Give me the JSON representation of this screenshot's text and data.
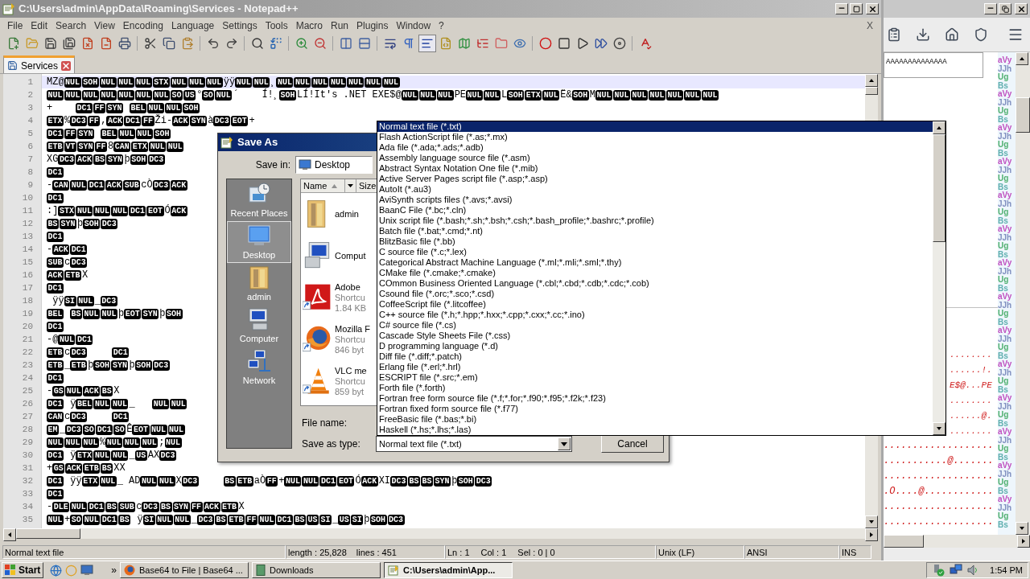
{
  "window": {
    "title": "C:\\Users\\admin\\AppData\\Roaming\\Services - Notepad++",
    "doc_close": "X"
  },
  "menu": [
    "File",
    "Edit",
    "Search",
    "View",
    "Encoding",
    "Language",
    "Settings",
    "Tools",
    "Macro",
    "Run",
    "Plugins",
    "Window",
    "?"
  ],
  "toolbar": [
    {
      "pressed": false
    },
    {
      "pressed": false
    },
    {
      "pressed": false
    },
    {
      "pressed": false
    },
    {
      "pressed": false
    },
    {
      "pressed": false
    },
    {
      "pressed": false
    },
    {
      "pressed": false
    },
    {
      "pressed": false
    },
    {
      "pressed": false
    },
    {
      "pressed": false
    },
    {
      "pressed": false
    },
    {
      "pressed": false
    },
    {
      "pressed": false
    },
    {
      "pressed": false
    },
    {
      "pressed": false
    },
    {
      "pressed": false
    },
    {
      "pressed": false
    },
    {
      "pressed": false
    },
    {
      "pressed": false
    },
    {
      "pressed": true
    },
    {
      "pressed": false
    },
    {
      "pressed": false
    },
    {
      "pressed": false
    },
    {
      "pressed": false
    },
    {
      "pressed": false
    },
    {
      "pressed": false
    },
    {
      "pressed": false
    },
    {
      "pressed": false
    },
    {
      "pressed": false
    },
    {
      "pressed": false
    },
    {
      "pressed": false
    }
  ],
  "tabs": [
    {
      "label": "Services",
      "selected": true
    }
  ],
  "editor": {
    "lines": [
      {
        "num": "1",
        "current": true,
        "segments": [
          {
            "kind": "text",
            "text": "MZ@"
          },
          {
            "kind": "ctrl",
            "codes": [
              "NUL",
              "SOH",
              "NUL",
              "NUL",
              "NUL",
              "STX",
              "NUL",
              "NUL",
              "NUL"
            ]
          },
          {
            "kind": "text",
            "text": "ÿÿ"
          },
          {
            "kind": "ctrl",
            "codes": [
              "NUL",
              "NUL"
            ]
          },
          {
            "kind": "text",
            "text": "¸"
          },
          {
            "kind": "ctrl",
            "codes": [
              "NUL",
              "NUL",
              "NUL",
              "NUL",
              "NUL",
              "NUL",
              "NUL"
            ]
          }
        ]
      },
      {
        "num": "2",
        "current": false,
        "segments": [
          {
            "kind": "ctrl",
            "codes": [
              "NUL",
              "NUL",
              "NUL",
              "NUL",
              "NUL",
              "NUL",
              "NUL",
              "SO",
              "US"
            ]
          },
          {
            "kind": "text",
            "text": "°"
          },
          {
            "kind": "ctrl",
            "codes": [
              "SO",
              "NUL"
            ]
          },
          {
            "kind": "text",
            "text": "´    Í!¸"
          },
          {
            "kind": "ctrl",
            "codes": [
              "SOH"
            ]
          },
          {
            "kind": "text",
            "text": "LÍ!It's .NET EXE$@"
          },
          {
            "kind": "ctrl",
            "codes": [
              "NUL",
              "NUL",
              "NUL"
            ]
          },
          {
            "kind": "text",
            "text": "PE"
          },
          {
            "kind": "ctrl",
            "codes": [
              "NUL",
              "NUL"
            ]
          },
          {
            "kind": "text",
            "text": "L"
          },
          {
            "kind": "ctrl",
            "codes": [
              "SOH",
              "ETX",
              "NUL"
            ]
          },
          {
            "kind": "text",
            "text": "Ë&"
          },
          {
            "kind": "ctrl",
            "codes": [
              "SOH"
            ]
          },
          {
            "kind": "text",
            "text": "M"
          },
          {
            "kind": "ctrl",
            "codes": [
              "NUL",
              "NUL",
              "NUL",
              "NUL",
              "NUL",
              "NUL",
              "NUL"
            ]
          }
        ]
      },
      {
        "num": "3",
        "current": false,
        "segments": [
          {
            "kind": "text",
            "text": "+    "
          },
          {
            "kind": "ctrl",
            "codes": [
              "DC1",
              "FF",
              "SYN"
            ]
          },
          {
            "kind": "space"
          },
          {
            "kind": "ctrl",
            "codes": [
              "BEL",
              "NUL",
              "NUL",
              "SOH"
            ]
          }
        ]
      },
      {
        "num": "4",
        "current": false,
        "segments": [
          {
            "kind": "ctrl",
            "codes": [
              "ETX"
            ]
          },
          {
            "kind": "text",
            "text": "%"
          },
          {
            "kind": "ctrl",
            "codes": [
              "DC3",
              "FF"
            ]
          },
          {
            "kind": "text",
            "text": ","
          },
          {
            "kind": "ctrl",
            "codes": [
              "ACK",
              "DC1",
              "FF"
            ]
          },
          {
            "kind": "text",
            "text": "Ži-"
          },
          {
            "kind": "ctrl",
            "codes": [
              "ACK",
              "SYN"
            ]
          },
          {
            "kind": "text",
            "text": "à"
          },
          {
            "kind": "ctrl",
            "codes": [
              "DC3",
              "EOT"
            ]
          },
          {
            "kind": "text",
            "text": "+"
          }
        ]
      },
      {
        "num": "5",
        "current": false,
        "segments": [
          {
            "kind": "ctrl",
            "codes": [
              "DC1",
              "FF",
              "SYN"
            ]
          },
          {
            "kind": "space"
          },
          {
            "kind": "ctrl",
            "codes": [
              "BEL",
              "NUL",
              "NUL",
              "SOH"
            ]
          }
        ]
      },
      {
        "num": "6",
        "current": false,
        "segments": [
          {
            "kind": "ctrl",
            "codes": [
              "ETB",
              "VT",
              "SYN",
              "FF"
            ]
          },
          {
            "kind": "text",
            "text": "8"
          },
          {
            "kind": "ctrl",
            "codes": [
              "CAN",
              "ETX",
              "NUL",
              "NUL"
            ]
          }
        ]
      },
      {
        "num": "7",
        "current": false,
        "segments": [
          {
            "kind": "text",
            "text": "XG"
          },
          {
            "kind": "ctrl",
            "codes": [
              "DC3",
              "ACK",
              "BS",
              "SYN"
            ]
          },
          {
            "kind": "text",
            "text": "þ"
          },
          {
            "kind": "ctrl",
            "codes": [
              "SOH",
              "DC3"
            ]
          }
        ]
      },
      {
        "num": "8",
        "current": false,
        "segments": [
          {
            "kind": "ctrl",
            "codes": [
              "DC1"
            ]
          }
        ]
      },
      {
        "num": "9",
        "current": false,
        "segments": [
          {
            "kind": "text",
            "text": "-"
          },
          {
            "kind": "ctrl",
            "codes": [
              "CAN",
              "NUL",
              "DC1",
              "ACK",
              "SUB"
            ]
          },
          {
            "kind": "text",
            "text": "cÒ"
          },
          {
            "kind": "ctrl",
            "codes": [
              "DC3",
              "ACK"
            ]
          }
        ]
      },
      {
        "num": "10",
        "current": false,
        "segments": [
          {
            "kind": "ctrl",
            "codes": [
              "DC1"
            ]
          }
        ]
      },
      {
        "num": "11",
        "current": false,
        "segments": [
          {
            "kind": "text",
            "text": ":]"
          },
          {
            "kind": "ctrl",
            "codes": [
              "STX",
              "NUL",
              "NUL",
              "NUL",
              "DC1",
              "EOT"
            ]
          },
          {
            "kind": "text",
            "text": "Ó"
          },
          {
            "kind": "ctrl",
            "codes": [
              "ACK"
            ]
          }
        ]
      },
      {
        "num": "12",
        "current": false,
        "segments": [
          {
            "kind": "ctrl",
            "codes": [
              "BS",
              "SYN"
            ]
          },
          {
            "kind": "text",
            "text": "þ"
          },
          {
            "kind": "ctrl",
            "codes": [
              "SOH",
              "DC3"
            ]
          }
        ]
      },
      {
        "num": "13",
        "current": false,
        "segments": [
          {
            "kind": "ctrl",
            "codes": [
              "DC1"
            ]
          }
        ]
      },
      {
        "num": "14",
        "current": false,
        "segments": [
          {
            "kind": "text",
            "text": "-"
          },
          {
            "kind": "ctrl",
            "codes": [
              "ACK",
              "DC1"
            ]
          }
        ]
      },
      {
        "num": "15",
        "current": false,
        "segments": [
          {
            "kind": "ctrl",
            "codes": [
              "SUB"
            ]
          },
          {
            "kind": "text",
            "text": "c"
          },
          {
            "kind": "ctrl",
            "codes": [
              "DC3"
            ]
          }
        ]
      },
      {
        "num": "16",
        "current": false,
        "segments": [
          {
            "kind": "ctrl",
            "codes": [
              "ACK",
              "ETB"
            ]
          },
          {
            "kind": "text",
            "text": "X"
          }
        ]
      },
      {
        "num": "17",
        "current": false,
        "segments": [
          {
            "kind": "ctrl",
            "codes": [
              "DC1"
            ]
          }
        ]
      },
      {
        "num": "18",
        "current": false,
        "segments": [
          {
            "kind": "text",
            "text": " ÿÿ"
          },
          {
            "kind": "ctrl",
            "codes": [
              "SI",
              "NUL"
            ]
          },
          {
            "kind": "text",
            "text": "_"
          },
          {
            "kind": "ctrl",
            "codes": [
              "DC3"
            ]
          }
        ]
      },
      {
        "num": "19",
        "current": false,
        "segments": [
          {
            "kind": "ctrl",
            "codes": [
              "BEL"
            ]
          },
          {
            "kind": "space"
          },
          {
            "kind": "ctrl",
            "codes": [
              "BS",
              "NUL",
              "NUL"
            ]
          },
          {
            "kind": "text",
            "text": "þ"
          },
          {
            "kind": "ctrl",
            "codes": [
              "EOT",
              "SYN"
            ]
          },
          {
            "kind": "text",
            "text": "þ"
          },
          {
            "kind": "ctrl",
            "codes": [
              "SOH"
            ]
          }
        ]
      },
      {
        "num": "20",
        "current": false,
        "segments": [
          {
            "kind": "ctrl",
            "codes": [
              "DC1"
            ]
          }
        ]
      },
      {
        "num": "21",
        "current": false,
        "segments": [
          {
            "kind": "text",
            "text": "-@"
          },
          {
            "kind": "ctrl",
            "codes": [
              "NUL",
              "DC1"
            ]
          }
        ]
      },
      {
        "num": "22",
        "current": false,
        "segments": [
          {
            "kind": "ctrl",
            "codes": [
              "ETB"
            ]
          },
          {
            "kind": "text",
            "text": "c"
          },
          {
            "kind": "ctrl",
            "codes": [
              "DC3"
            ]
          },
          {
            "kind": "tab"
          },
          {
            "kind": "ctrl",
            "codes": [
              "DC1"
            ]
          }
        ]
      },
      {
        "num": "23",
        "current": false,
        "segments": [
          {
            "kind": "ctrl",
            "codes": [
              "ETB"
            ]
          },
          {
            "kind": "text",
            "text": "_"
          },
          {
            "kind": "ctrl",
            "codes": [
              "ETB"
            ]
          },
          {
            "kind": "text",
            "text": "þ"
          },
          {
            "kind": "ctrl",
            "codes": [
              "SOH",
              "SYN"
            ]
          },
          {
            "kind": "text",
            "text": "þ"
          },
          {
            "kind": "ctrl",
            "codes": [
              "SOH",
              "DC3"
            ]
          }
        ]
      },
      {
        "num": "24",
        "current": false,
        "segments": [
          {
            "kind": "ctrl",
            "codes": [
              "DC1"
            ]
          }
        ]
      },
      {
        "num": "25",
        "current": false,
        "segments": [
          {
            "kind": "text",
            "text": "-"
          },
          {
            "kind": "ctrl",
            "codes": [
              "GS",
              "NUL",
              "ACK",
              "BS"
            ]
          },
          {
            "kind": "text",
            "text": "X"
          }
        ]
      },
      {
        "num": "26",
        "current": false,
        "segments": [
          {
            "kind": "ctrl",
            "codes": [
              "DC1"
            ]
          },
          {
            "kind": "text",
            "text": " ÿ"
          },
          {
            "kind": "ctrl",
            "codes": [
              "BEL",
              "NUL",
              "NUL"
            ]
          },
          {
            "kind": "text",
            "text": "_   "
          },
          {
            "kind": "ctrl",
            "codes": [
              "NUL",
              "NUL"
            ]
          }
        ]
      },
      {
        "num": "27",
        "current": false,
        "segments": [
          {
            "kind": "ctrl",
            "codes": [
              "CAN"
            ]
          },
          {
            "kind": "text",
            "text": "c"
          },
          {
            "kind": "ctrl",
            "codes": [
              "DC3"
            ]
          },
          {
            "kind": "tab"
          },
          {
            "kind": "ctrl",
            "codes": [
              "DC1"
            ]
          }
        ]
      },
      {
        "num": "28",
        "current": false,
        "segments": [
          {
            "kind": "ctrl",
            "codes": [
              "EM"
            ]
          },
          {
            "kind": "text",
            "text": "_"
          },
          {
            "kind": "ctrl",
            "codes": [
              "DC3",
              "SO",
              "DC1",
              "SO"
            ]
          },
          {
            "kind": "text",
            "text": "Ê"
          },
          {
            "kind": "ctrl",
            "codes": [
              "EOT",
              "NUL",
              "NUL"
            ]
          }
        ]
      },
      {
        "num": "29",
        "current": false,
        "segments": [
          {
            "kind": "ctrl",
            "codes": [
              "NUL",
              "NUL",
              "NUL"
            ]
          },
          {
            "kind": "text",
            "text": "%"
          },
          {
            "kind": "ctrl",
            "codes": [
              "NUL",
              "NUL",
              "NUL"
            ]
          },
          {
            "kind": "text",
            "text": ";"
          },
          {
            "kind": "ctrl",
            "codes": [
              "NUL"
            ]
          }
        ]
      },
      {
        "num": "30",
        "current": false,
        "segments": [
          {
            "kind": "ctrl",
            "codes": [
              "DC1"
            ]
          },
          {
            "kind": "text",
            "text": " ÿ"
          },
          {
            "kind": "ctrl",
            "codes": [
              "ETX",
              "NUL",
              "NUL"
            ]
          },
          {
            "kind": "text",
            "text": "_"
          },
          {
            "kind": "ctrl",
            "codes": [
              "US"
            ]
          },
          {
            "kind": "text",
            "text": "AX"
          },
          {
            "kind": "ctrl",
            "codes": [
              "DC3"
            ]
          }
        ]
      },
      {
        "num": "31",
        "current": false,
        "segments": [
          {
            "kind": "text",
            "text": "+"
          },
          {
            "kind": "ctrl",
            "codes": [
              "GS",
              "ACK",
              "ETB",
              "BS"
            ]
          },
          {
            "kind": "text",
            "text": "XX"
          }
        ]
      },
      {
        "num": "32",
        "current": false,
        "segments": [
          {
            "kind": "ctrl",
            "codes": [
              "DC1"
            ]
          },
          {
            "kind": "text",
            "text": " ÿÿ"
          },
          {
            "kind": "ctrl",
            "codes": [
              "ETX",
              "NUL"
            ]
          },
          {
            "kind": "text",
            "text": "_ AD"
          },
          {
            "kind": "ctrl",
            "codes": [
              "NUL",
              "NUL"
            ]
          },
          {
            "kind": "text",
            "text": "X"
          },
          {
            "kind": "ctrl",
            "codes": [
              "DC3"
            ]
          },
          {
            "kind": "tab"
          },
          {
            "kind": "ctrl",
            "codes": [
              "BS",
              "ETB"
            ]
          },
          {
            "kind": "text",
            "text": "aÒ"
          },
          {
            "kind": "ctrl",
            "codes": [
              "FF"
            ]
          },
          {
            "kind": "text",
            "text": "+"
          },
          {
            "kind": "ctrl",
            "codes": [
              "NUL",
              "NUL",
              "DC1",
              "EOT"
            ]
          },
          {
            "kind": "text",
            "text": "Ó"
          },
          {
            "kind": "ctrl",
            "codes": [
              "ACK"
            ]
          },
          {
            "kind": "text",
            "text": "XI"
          },
          {
            "kind": "ctrl",
            "codes": [
              "DC3",
              "BS",
              "BS",
              "SYN"
            ]
          },
          {
            "kind": "text",
            "text": "þ"
          },
          {
            "kind": "ctrl",
            "codes": [
              "SOH",
              "DC3"
            ]
          }
        ]
      },
      {
        "num": "33",
        "current": false,
        "segments": [
          {
            "kind": "ctrl",
            "codes": [
              "DC1"
            ]
          }
        ]
      },
      {
        "num": "34",
        "current": false,
        "segments": [
          {
            "kind": "text",
            "text": "-"
          },
          {
            "kind": "ctrl",
            "codes": [
              "DLE",
              "NUL",
              "DC1",
              "BS",
              "SUB"
            ]
          },
          {
            "kind": "text",
            "text": "c"
          },
          {
            "kind": "ctrl",
            "codes": [
              "DC3",
              "BS",
              "SYN",
              "FF",
              "ACK",
              "ETB"
            ]
          },
          {
            "kind": "text",
            "text": "X"
          }
        ]
      },
      {
        "num": "35",
        "current": false,
        "segments": [
          {
            "kind": "ctrl",
            "codes": [
              "NUL"
            ]
          },
          {
            "kind": "text",
            "text": "+"
          },
          {
            "kind": "ctrl",
            "codes": [
              "SO",
              "NUL",
              "DC1",
              "BS"
            ]
          },
          {
            "kind": "text",
            "text": " ÿ"
          },
          {
            "kind": "ctrl",
            "codes": [
              "SI",
              "NUL",
              "NUL"
            ]
          },
          {
            "kind": "text",
            "text": "_"
          },
          {
            "kind": "ctrl",
            "codes": [
              "DC3",
              "BS",
              "ETB",
              "FF",
              "NUL",
              "DC1",
              "BS",
              "US",
              "SI"
            ]
          },
          {
            "kind": "text",
            "text": "_"
          },
          {
            "kind": "ctrl",
            "codes": [
              "US",
              "SI"
            ]
          },
          {
            "kind": "text",
            "text": "þ"
          },
          {
            "kind": "ctrl",
            "codes": [
              "SOH",
              "DC3"
            ]
          }
        ]
      }
    ]
  },
  "status_bar": {
    "file_type": "Normal text file",
    "length": "length : 25,828",
    "lines": "lines : 451",
    "line": "Ln : 1",
    "column": "Col : 1",
    "selection": "Sel : 0 | 0",
    "eol": "Unix (LF)",
    "encoding": "ANSI",
    "mode": "INS"
  },
  "save_as_dialog": {
    "title": "Save As",
    "save_in_label": "Save in:",
    "save_in_value": "Desktop",
    "places": [
      {
        "label": "Recent Places",
        "kind": "recent",
        "selected": false
      },
      {
        "label": "Desktop",
        "kind": "desktop",
        "selected": true
      },
      {
        "label": "admin",
        "kind": "user",
        "selected": false
      },
      {
        "label": "Computer",
        "kind": "computer",
        "selected": false
      },
      {
        "label": "Network",
        "kind": "network",
        "selected": false
      }
    ],
    "columns": [
      "Name",
      "Size"
    ],
    "files": [
      {
        "name": "admin",
        "kind": "folder"
      },
      {
        "name": "Comput",
        "kind": "computer"
      },
      {
        "name": "Adobe",
        "kind": "pdf",
        "type": "Shortcu",
        "size": "1.84 KB"
      },
      {
        "name": "Mozilla F",
        "kind": "firefox",
        "type": "Shortcu",
        "size": "846 byt"
      },
      {
        "name": "VLC me",
        "kind": "vlc",
        "type": "Shortcu",
        "size": "859 byt"
      }
    ],
    "file_name_label": "File name:",
    "type_label": "Save as type:",
    "type_value": "Normal text file (*.txt)",
    "cancel": "Cancel"
  },
  "type_list": [
    {
      "label": "Normal text file (*.txt)",
      "selected": true
    },
    {
      "label": "Flash ActionScript file (*.as;*.mx)",
      "selected": false
    },
    {
      "label": "Ada file (*.ada;*.ads;*.adb)",
      "selected": false
    },
    {
      "label": "Assembly language source file (*.asm)",
      "selected": false
    },
    {
      "label": "Abstract Syntax Notation One file (*.mib)",
      "selected": false
    },
    {
      "label": "Active Server Pages script file (*.asp;*.asp)",
      "selected": false
    },
    {
      "label": "AutoIt (*.au3)",
      "selected": false
    },
    {
      "label": "AviSynth scripts files (*.avs;*.avsi)",
      "selected": false
    },
    {
      "label": "BaanC File (*.bc;*.cln)",
      "selected": false
    },
    {
      "label": "Unix script file (*.bash;*.sh;*.bsh;*.csh;*.bash_profile;*.bashrc;*.profile)",
      "selected": false
    },
    {
      "label": "Batch file (*.bat;*.cmd;*.nt)",
      "selected": false
    },
    {
      "label": "BlitzBasic file (*.bb)",
      "selected": false
    },
    {
      "label": "C source file (*.c;*.lex)",
      "selected": false
    },
    {
      "label": "Categorical Abstract Machine Language (*.ml;*.mli;*.sml;*.thy)",
      "selected": false
    },
    {
      "label": "CMake file (*.cmake;*.cmake)",
      "selected": false
    },
    {
      "label": "COmmon Business Oriented Language (*.cbl;*.cbd;*.cdb;*.cdc;*.cob)",
      "selected": false
    },
    {
      "label": "Csound file (*.orc;*.sco;*.csd)",
      "selected": false
    },
    {
      "label": "CoffeeScript file (*.litcoffee)",
      "selected": false
    },
    {
      "label": "C++ source file (*.h;*.hpp;*.hxx;*.cpp;*.cxx;*.cc;*.ino)",
      "selected": false
    },
    {
      "label": "C# source file (*.cs)",
      "selected": false
    },
    {
      "label": "Cascade Style Sheets File (*.css)",
      "selected": false
    },
    {
      "label": "D programming language (*.d)",
      "selected": false
    },
    {
      "label": "Diff file (*.diff;*.patch)",
      "selected": false
    },
    {
      "label": "Erlang file (*.erl;*.hrl)",
      "selected": false
    },
    {
      "label": "ESCRIPT file (*.src;*.em)",
      "selected": false
    },
    {
      "label": "Forth file (*.forth)",
      "selected": false
    },
    {
      "label": "Fortran free form source file (*.f;*.for;*.f90;*.f95;*.f2k;*.f23)",
      "selected": false
    },
    {
      "label": "Fortran fixed form source file (*.f77)",
      "selected": false
    },
    {
      "label": "FreeBasic file (*.bas;*.bi)",
      "selected": false
    },
    {
      "label": "Haskell (*.hs;*.lhs;*.las)",
      "selected": false
    }
  ],
  "browser": {
    "textarea_line": "AAAAAAAAAAAAAA",
    "hex_rows_beside_menu": [
      "........",
      "......!.",
      "E$@...PE",
      "........",
      "......@.",
      "........"
    ],
    "hex_rows": [
      "...................",
      "...........@.......",
      "...................",
      ".O....@............",
      "...................",
      "..................."
    ],
    "strip": [
      {
        "text": "aVy",
        "color": "#c050c0"
      },
      {
        "text": "JJh",
        "color": "#8090c0"
      },
      {
        "text": "Ug",
        "color": "#50b070"
      },
      {
        "text": "Bs",
        "color": "#60b0b0"
      },
      {
        "text": "aVy",
        "color": "#c050c0"
      },
      {
        "text": "JJh",
        "color": "#8090c0"
      },
      {
        "text": "Ug",
        "color": "#50b070"
      },
      {
        "text": "Bs",
        "color": "#60b0b0"
      },
      {
        "text": "aVy",
        "color": "#c050c0"
      },
      {
        "text": "JJh",
        "color": "#8090c0"
      },
      {
        "text": "Ug",
        "color": "#50b070"
      },
      {
        "text": "Bs",
        "color": "#60b0b0"
      },
      {
        "text": "aVy",
        "color": "#c050c0"
      },
      {
        "text": "JJh",
        "color": "#8090c0"
      },
      {
        "text": "Ug",
        "color": "#50b070"
      },
      {
        "text": "Bs",
        "color": "#60b0b0"
      },
      {
        "text": "aVy",
        "color": "#c050c0"
      },
      {
        "text": "JJh",
        "color": "#8090c0"
      },
      {
        "text": "Ug",
        "color": "#50b070"
      },
      {
        "text": "Bs",
        "color": "#60b0b0"
      },
      {
        "text": "aVy",
        "color": "#c050c0"
      },
      {
        "text": "JJh",
        "color": "#8090c0"
      },
      {
        "text": "Ug",
        "color": "#50b070"
      },
      {
        "text": "Bs",
        "color": "#60b0b0"
      },
      {
        "text": "aVy",
        "color": "#c050c0"
      },
      {
        "text": "JJh",
        "color": "#8090c0"
      },
      {
        "text": "Ug",
        "color": "#50b070"
      },
      {
        "text": "Bs",
        "color": "#60b0b0"
      },
      {
        "text": "aVy",
        "color": "#c050c0"
      },
      {
        "text": "JJh",
        "color": "#8090c0"
      },
      {
        "text": "Ug",
        "color": "#50b070"
      },
      {
        "text": "Bs",
        "color": "#60b0b0"
      },
      {
        "text": "aVy",
        "color": "#c050c0"
      },
      {
        "text": "JJh",
        "color": "#8090c0"
      },
      {
        "text": "Ug",
        "color": "#50b070"
      },
      {
        "text": "Bs",
        "color": "#60b0b0"
      },
      {
        "text": "aVy",
        "color": "#c050c0"
      },
      {
        "text": "JJh",
        "color": "#8090c0"
      },
      {
        "text": "Ug",
        "color": "#50b070"
      },
      {
        "text": "Bs",
        "color": "#60b0b0"
      },
      {
        "text": "aVy",
        "color": "#c050c0"
      },
      {
        "text": "JJh",
        "color": "#8090c0"
      },
      {
        "text": "Ug",
        "color": "#50b070"
      },
      {
        "text": "Bs",
        "color": "#60b0b0"
      },
      {
        "text": "aVy",
        "color": "#c050c0"
      },
      {
        "text": "JJh",
        "color": "#8090c0"
      },
      {
        "text": "Ug",
        "color": "#50b070"
      },
      {
        "text": "Bs",
        "color": "#60b0b0"
      },
      {
        "text": "aVy",
        "color": "#c050c0"
      },
      {
        "text": "JJh",
        "color": "#8090c0"
      },
      {
        "text": "Ug",
        "color": "#50b070"
      },
      {
        "text": "Bs",
        "color": "#60b0b0"
      },
      {
        "text": "aVy",
        "color": "#c050c0"
      },
      {
        "text": "JJh",
        "color": "#8090c0"
      },
      {
        "text": "Ug",
        "color": "#50b070"
      },
      {
        "text": "Bs",
        "color": "#60b0b0"
      }
    ]
  },
  "taskbar": {
    "start": "Start",
    "more": "»",
    "tasks": [
      {
        "label": "Base64 to File | Base64 ...",
        "kind": "browser",
        "selected": false
      },
      {
        "label": "Downloads",
        "kind": "folder",
        "selected": false
      },
      {
        "label": "C:\\Users\\admin\\App...",
        "kind": "editor",
        "selected": true
      }
    ],
    "clock": "1:54 PM"
  }
}
